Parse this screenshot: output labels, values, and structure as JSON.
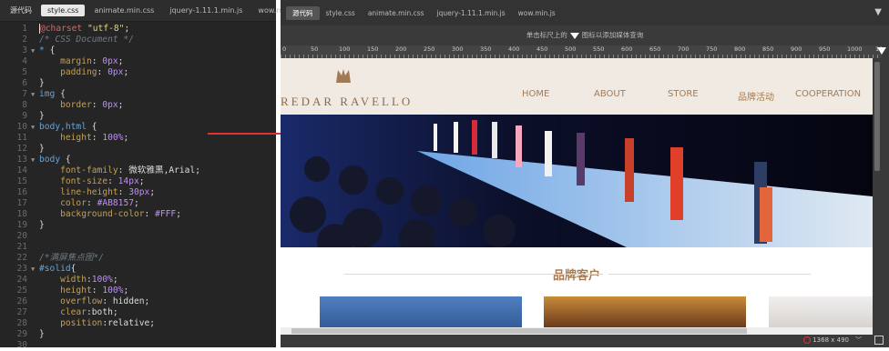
{
  "left_tabs": [
    "源代码",
    "style.css",
    "animate.min.css",
    "jquery-1.11.1.min.js",
    "wow.min.js"
  ],
  "code_lines": [
    {
      "n": "1",
      "fold": "",
      "html": "<span class='cursor'></span><span class='at'>@charset</span> <span class='s'>\"utf-8\"</span><span class='pl'>;</span>"
    },
    {
      "n": "2",
      "fold": "",
      "html": "<span class='c'>/* CSS Document */</span>"
    },
    {
      "n": "3",
      "fold": "▼",
      "html": "<span class='sel'>*</span> <span class='pl'>{</span>"
    },
    {
      "n": "4",
      "fold": "",
      "html": "    <span class='p'>margin</span><span class='pl'>:</span> <span class='v'>0px</span><span class='pl'>;</span>"
    },
    {
      "n": "5",
      "fold": "",
      "html": "    <span class='p'>padding</span><span class='pl'>:</span> <span class='v'>0px</span><span class='pl'>;</span>"
    },
    {
      "n": "6",
      "fold": "",
      "html": "<span class='pl'>}</span>"
    },
    {
      "n": "7",
      "fold": "▼",
      "html": "<span class='sel'>img</span> <span class='pl'>{</span>"
    },
    {
      "n": "8",
      "fold": "",
      "html": "    <span class='p'>border</span><span class='pl'>:</span> <span class='v'>0px</span><span class='pl'>;</span>"
    },
    {
      "n": "9",
      "fold": "",
      "html": "<span class='pl'>}</span>"
    },
    {
      "n": "10",
      "fold": "▼",
      "html": "<span class='sel'>body,html</span> <span class='pl'>{</span>"
    },
    {
      "n": "11",
      "fold": "",
      "html": "    <span class='p'>height</span><span class='pl'>:</span> <span class='v'>100%</span><span class='pl'>;</span>"
    },
    {
      "n": "12",
      "fold": "",
      "html": "<span class='pl'>}</span>"
    },
    {
      "n": "13",
      "fold": "▼",
      "html": "<span class='sel'>body</span> <span class='pl'>{</span>"
    },
    {
      "n": "14",
      "fold": "",
      "html": "    <span class='p'>font-family</span><span class='pl'>: 微软雅黑,Arial;</span>"
    },
    {
      "n": "15",
      "fold": "",
      "html": "    <span class='p'>font-size</span><span class='pl'>:</span> <span class='v'>14px</span><span class='pl'>;</span>"
    },
    {
      "n": "16",
      "fold": "",
      "html": "    <span class='p'>line-height</span><span class='pl'>:</span> <span class='v'>30px</span><span class='pl'>;</span>"
    },
    {
      "n": "17",
      "fold": "",
      "html": "    <span class='p'>color</span><span class='pl'>:</span> <span class='v'>#AB8157</span><span class='pl'>;</span>"
    },
    {
      "n": "18",
      "fold": "",
      "html": "    <span class='p'>background-color</span><span class='pl'>:</span> <span class='v'>#FFF</span><span class='pl'>;</span>"
    },
    {
      "n": "19",
      "fold": "",
      "html": "<span class='pl'>}</span>"
    },
    {
      "n": "20",
      "fold": "",
      "html": ""
    },
    {
      "n": "21",
      "fold": "",
      "html": ""
    },
    {
      "n": "22",
      "fold": "",
      "html": "<span class='c'>/*满屏焦点图*/</span>"
    },
    {
      "n": "23",
      "fold": "▼",
      "html": "<span class='sel'>#solid</span><span class='pl'>{</span>"
    },
    {
      "n": "24",
      "fold": "",
      "html": "    <span class='p'>width</span><span class='pl'>:</span><span class='v'>100%</span><span class='pl'>;</span>"
    },
    {
      "n": "25",
      "fold": "",
      "html": "    <span class='p'>height</span><span class='pl'>:</span> <span class='v'>100%</span><span class='pl'>;</span>"
    },
    {
      "n": "26",
      "fold": "",
      "html": "    <span class='p'>overflow</span><span class='pl'>: hidden;</span>"
    },
    {
      "n": "27",
      "fold": "",
      "html": "    <span class='p'>clear</span><span class='pl'>:both;</span>"
    },
    {
      "n": "28",
      "fold": "",
      "html": "    <span class='p'>position</span><span class='pl'>:relative;</span>"
    },
    {
      "n": "29",
      "fold": "",
      "html": "<span class='pl'>}</span>"
    },
    {
      "n": "30",
      "fold": "",
      "html": ""
    }
  ],
  "right_tabs": [
    "源代码",
    "style.css",
    "animate.min.css",
    "jquery-1.11.1.min.js",
    "wow.min.js"
  ],
  "ruler_tip": "单击标尺上的",
  "ruler_tip_suffix": "图标以添加媒体查询",
  "ruler_labels": [
    "0",
    "50",
    "100",
    "150",
    "200",
    "250",
    "300",
    "350",
    "400",
    "450",
    "500",
    "550",
    "600",
    "650",
    "700",
    "750",
    "800",
    "850",
    "900",
    "950",
    "1000",
    "105"
  ],
  "site": {
    "logo_text": "REDAR RAVELLO",
    "nav": [
      "HOME",
      "ABOUT",
      "STORE",
      "品牌活动",
      "COOPERATION"
    ],
    "section_title": "品牌客户"
  },
  "status": {
    "resolution": "1368 x 490",
    "dropdown": "﹀"
  }
}
